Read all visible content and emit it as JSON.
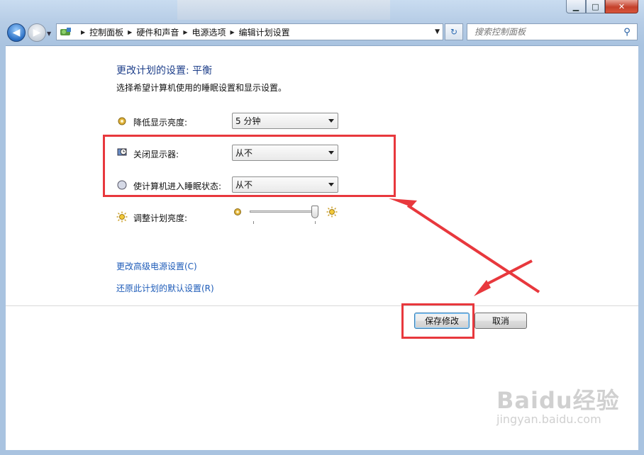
{
  "window": {
    "minimize_glyph": "▁",
    "maximize_glyph": "□",
    "close_glyph": "✕"
  },
  "address": {
    "crumbs": [
      "控制面板",
      "硬件和声音",
      "电源选项",
      "编辑计划设置"
    ]
  },
  "search": {
    "placeholder": "搜索控制面板"
  },
  "page": {
    "heading": "更改计划的设置: 平衡",
    "subtext": "选择希望计算机使用的睡眠设置和显示设置。"
  },
  "settings": [
    {
      "label": "降低显示亮度:",
      "value": "5 分钟",
      "icon": "dim-brightness-icon"
    },
    {
      "label": "关闭显示器:",
      "value": "从不",
      "icon": "monitor-clock-icon"
    },
    {
      "label": "使计算机进入睡眠状态:",
      "value": "从不",
      "icon": "moon-sleep-icon"
    }
  ],
  "brightness": {
    "label": "调整计划亮度:",
    "level": 0.95
  },
  "links": {
    "advanced": "更改高级电源设置(C)",
    "restore": "还原此计划的默认设置(R)"
  },
  "buttons": {
    "save": "保存修改",
    "cancel": "取消"
  },
  "watermark": {
    "logo": "Baidu经验",
    "url": "jingyan.baidu.com"
  },
  "colors": {
    "annotation_red": "#e8383d",
    "link_blue": "#1d5bb8",
    "heading_blue": "#1e3f8a"
  }
}
